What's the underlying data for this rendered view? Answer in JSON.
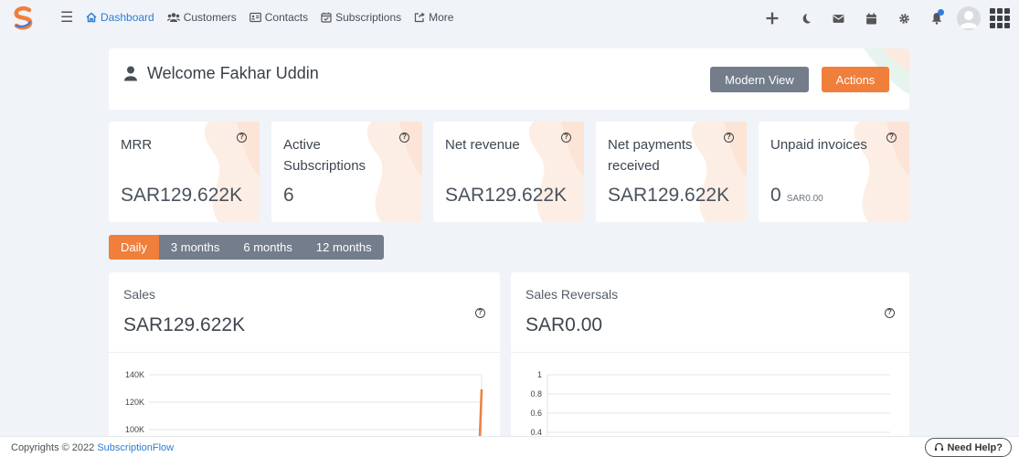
{
  "nav": {
    "links": [
      {
        "label": "Dashboard",
        "active": true
      },
      {
        "label": "Customers"
      },
      {
        "label": "Contacts"
      },
      {
        "label": "Subscriptions"
      },
      {
        "label": "More"
      }
    ]
  },
  "welcome": {
    "title": "Welcome Fakhar Uddin",
    "modern_view_label": "Modern View",
    "actions_label": "Actions"
  },
  "stats": [
    {
      "label": "MRR",
      "value": "SAR129.622K"
    },
    {
      "label": "Active Subscriptions",
      "value": "6"
    },
    {
      "label": "Net revenue",
      "value": "SAR129.622K"
    },
    {
      "label": "Net payments received",
      "value": "SAR129.622K"
    },
    {
      "label": "Unpaid invoices",
      "value": "0",
      "sub": "SAR0.00"
    }
  ],
  "periods": [
    "Daily",
    "3 months",
    "6 months",
    "12 months"
  ],
  "sales": {
    "title": "Sales",
    "value": "SAR129.622K",
    "y_ticks": [
      "140K",
      "120K",
      "100K"
    ]
  },
  "reversals": {
    "title": "Sales Reversals",
    "value": "SAR0.00",
    "y_ticks": [
      "1",
      "0.8",
      "0.6",
      "0.4"
    ]
  },
  "footer": {
    "copyright": "Copyrights © 2022",
    "brand": "SubscriptionFlow",
    "need_help": "Need Help?"
  },
  "colors": {
    "accent_orange": "#f07f3c",
    "gray_button": "#737d8c",
    "link_blue": "#2e7cd3",
    "background": "#f0f3f8"
  }
}
